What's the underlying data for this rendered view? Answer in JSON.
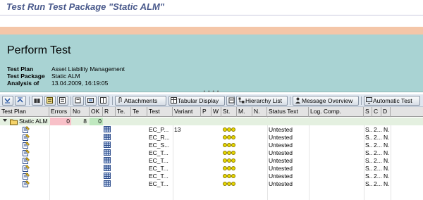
{
  "window": {
    "title": "Test Run Test Package \"Static ALM\""
  },
  "header": {
    "title": "Perform Test",
    "fields": [
      {
        "label": "Test Plan",
        "value": "Asset Liability Management"
      },
      {
        "label": "Test Package",
        "value": "Static ALM"
      },
      {
        "label": "Analysis of",
        "value": "13.04.2009, 16:19:05"
      }
    ]
  },
  "toolbar": {
    "attachments_label": "Attachments",
    "tabular_label": "Tabular Display",
    "hierarchy_label": "Hierarchy List",
    "message_label": "Message Overview",
    "automatic_label": "Automatic Test"
  },
  "columns": [
    "Test Plan",
    "Errors",
    "No",
    "OK",
    "R",
    "Te.",
    "Te",
    "Test",
    "Variant",
    "P",
    "W",
    "St.",
    "M.",
    "N.",
    "Status Text",
    "Log. Comp.",
    "S",
    "C",
    "D"
  ],
  "root": {
    "name": "Static ALM",
    "errors": "0",
    "no": "8",
    "ok": "0"
  },
  "rows": [
    {
      "test": "EC_P...",
      "variant": "13",
      "status": "Untested",
      "s": "S...",
      "c": "2...",
      "d": "N."
    },
    {
      "test": "EC_R...",
      "variant": "",
      "status": "Untested",
      "s": "S...",
      "c": "2...",
      "d": "N."
    },
    {
      "test": "EC_S...",
      "variant": "",
      "status": "Untested",
      "s": "S...",
      "c": "2...",
      "d": "N."
    },
    {
      "test": "EC_T...",
      "variant": "",
      "status": "Untested",
      "s": "S...",
      "c": "2...",
      "d": "N."
    },
    {
      "test": "EC_T...",
      "variant": "",
      "status": "Untested",
      "s": "S...",
      "c": "2...",
      "d": "N."
    },
    {
      "test": "EC_T...",
      "variant": "",
      "status": "Untested",
      "s": "S...",
      "c": "2...",
      "d": "N."
    },
    {
      "test": "EC_T...",
      "variant": "",
      "status": "Untested",
      "s": "S...",
      "c": "2...",
      "d": "N."
    },
    {
      "test": "EC_T...",
      "variant": "",
      "status": "Untested",
      "s": "S...",
      "c": "2...",
      "d": "N."
    }
  ],
  "colors": {
    "header_bg": "#a9d3d3",
    "title_color": "#4a5a8c",
    "errors_bg": "#f8c0c8",
    "ok_bg": "#bfe8bf",
    "lamp": "#e8d800"
  }
}
